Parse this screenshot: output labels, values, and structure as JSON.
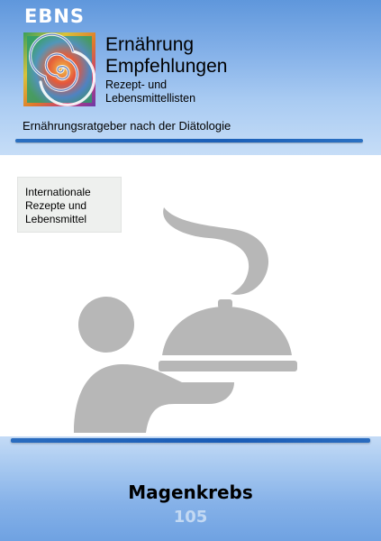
{
  "header": {
    "brand": "EBNS",
    "title_line1": "Ernährung",
    "title_line2": "Empfehlungen",
    "subtitle_line1": "Rezept- und",
    "subtitle_line2": "Lebensmittellisten",
    "tagline": "Ernährungsratgeber nach der Diätologie",
    "colors": {
      "band_top": "#5f97dc",
      "band_bottom": "#c6ddf7",
      "rule": "#1b5fb8"
    }
  },
  "category": {
    "line1": "Internationale",
    "line2": "Rezepte und",
    "line3": "Lebensmittel",
    "background": "#eef0ee"
  },
  "illustration": {
    "icon": "waiter-serving-cloche-icon",
    "color": "#b7b7b7"
  },
  "footer": {
    "title": "Magenkrebs",
    "volume": "105",
    "colors": {
      "band_top": "#c4dbf6",
      "band_bottom": "#6fa2e2",
      "volume_text": "#c3d9f3"
    }
  }
}
